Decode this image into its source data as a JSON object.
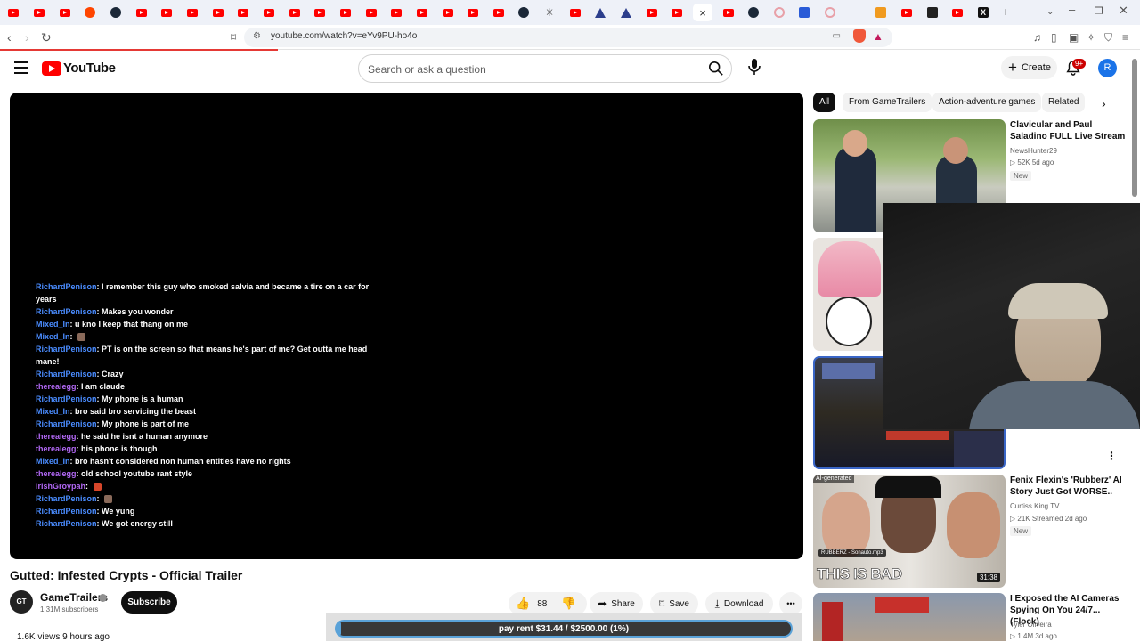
{
  "browser": {
    "url": "youtube.com/watch?v=eYv9PU-ho4o",
    "tab_close_glyph": "×"
  },
  "header": {
    "logo_text": "YouTube",
    "search_placeholder": "Search or ask a question",
    "create_label": "Create",
    "notification_count": "9+",
    "avatar_letter": "R"
  },
  "chat": [
    {
      "user": "RichardPenison",
      "color": "blue",
      "text": "I remember this guy who smoked salvia and became a tire on a car for years"
    },
    {
      "user": "RichardPenison",
      "color": "blue",
      "text": "Makes you wonder"
    },
    {
      "user": "Mixed_In",
      "color": "blue",
      "text": "u kno I keep that thang on me"
    },
    {
      "user": "Mixed_In",
      "color": "blue",
      "text": ""
    },
    {
      "user": "RichardPenison",
      "color": "blue",
      "text": "PT is on the screen so that means he's part of me? Get outta me head mane!"
    },
    {
      "user": "RichardPenison",
      "color": "blue",
      "text": "Crazy"
    },
    {
      "user": "therealegg",
      "color": "purple",
      "text": "I am claude"
    },
    {
      "user": "RichardPenison",
      "color": "blue",
      "text": "My phone is a human"
    },
    {
      "user": "Mixed_In",
      "color": "blue",
      "text": "bro said bro servicing the beast"
    },
    {
      "user": "RichardPenison",
      "color": "blue",
      "text": "My phone is part of me"
    },
    {
      "user": "therealegg",
      "color": "purple",
      "text": "he said he isnt a human anymore"
    },
    {
      "user": "therealegg",
      "color": "purple",
      "text": "his phone is though"
    },
    {
      "user": "Mixed_In",
      "color": "blue",
      "text": "bro hasn't considered non human entities have no rights"
    },
    {
      "user": "therealegg",
      "color": "purple",
      "text": "old school youtube rant style"
    },
    {
      "user": "IrishGroypah",
      "color": "purple",
      "text": ""
    },
    {
      "user": "RichardPenison",
      "color": "blue",
      "text": ""
    },
    {
      "user": "RichardPenison",
      "color": "blue",
      "text": "We yung"
    },
    {
      "user": "RichardPenison",
      "color": "blue",
      "text": "We got energy still"
    }
  ],
  "video": {
    "title": "Gutted: Infested Crypts - Official Trailer",
    "channel": "GameTrailers",
    "channel_avatar": "GT",
    "subscribers": "1.31M subscribers",
    "subscribe_label": "Subscribe",
    "likes": "88",
    "share_label": "Share",
    "save_label": "Save",
    "download_label": "Download",
    "more_label": "•••",
    "views_line": "1.6K views  9 hours ago"
  },
  "donation": {
    "text": "pay rent $31.44 / $2500.00 (1%)",
    "progress": 0.01
  },
  "chips": [
    {
      "label": "All",
      "selected": true
    },
    {
      "label": "From GameTrailers",
      "selected": false
    },
    {
      "label": "Action-adventure games",
      "selected": false
    },
    {
      "label": "Related",
      "selected": false
    }
  ],
  "recommendations": [
    {
      "title": "Clavicular and Paul Saladino FULL Live Stream",
      "channel": "NewsHunter29",
      "meta": "▷ 52K  5d ago",
      "badge": "New"
    },
    {
      "title": "Fenix Flexin's 'Rubberz' AI Story Just Got WORSE..",
      "channel": "Curtiss King TV",
      "meta": "▷ 21K  Streamed 2d ago",
      "badge": "New",
      "duration": "31:38",
      "overlay_top": "AI-generated",
      "overlay_caption": "THIS IS BAD",
      "overlay_track": "RUBBERZ - Sonauto.mp3"
    },
    {
      "title": "I Exposed the AI Cameras Spying On You 24/7... (Flock)",
      "channel": "Tyler Oliveira",
      "meta": "▷ 1.4M  3d ago"
    }
  ],
  "colors": {
    "yt_red": "#ff0000",
    "chat_user_blue": "#4a8cff",
    "chat_user_purple": "#b268f5",
    "donation_border": "#5aa2d8"
  }
}
